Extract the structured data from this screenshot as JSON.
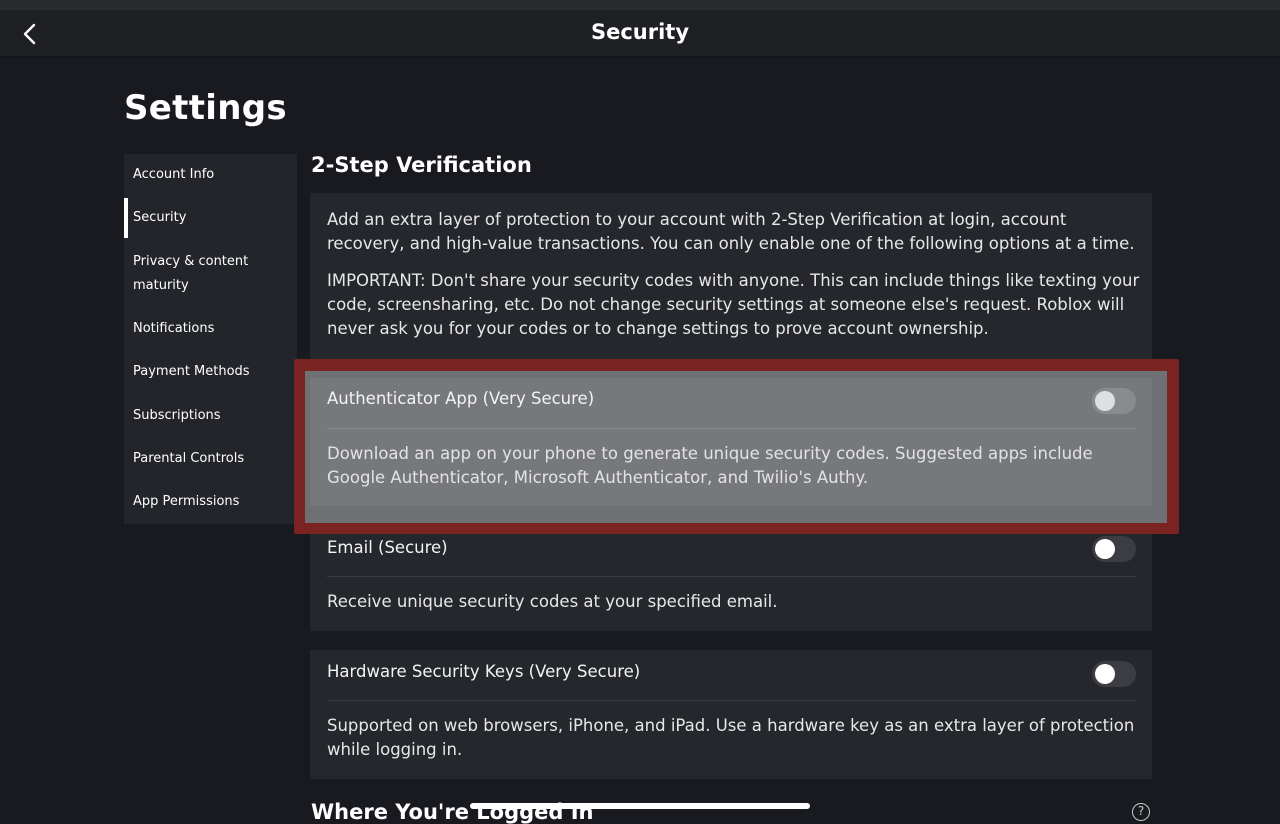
{
  "header": {
    "title": "Security",
    "back_icon": "chevron-left-icon"
  },
  "page": {
    "title": "Settings"
  },
  "sidebar": {
    "items": [
      {
        "label": "Account Info",
        "active": false
      },
      {
        "label": "Security",
        "active": true
      },
      {
        "label": "Privacy & content maturity",
        "active": false
      },
      {
        "label": "Notifications",
        "active": false
      },
      {
        "label": "Payment Methods",
        "active": false
      },
      {
        "label": "Subscriptions",
        "active": false
      },
      {
        "label": "Parental Controls",
        "active": false
      },
      {
        "label": "App Permissions",
        "active": false
      }
    ]
  },
  "two_step": {
    "title": "2-Step Verification",
    "intro": "Add an extra layer of protection to your account with 2-Step Verification at login, account recovery, and high-value transactions. You can only enable one of the following options at a time.",
    "important": "IMPORTANT: Don't share your security codes with anyone. This can include things like texting your code, screensharing, etc. Do not change security settings at someone else's request. Roblox will never ask you for your codes or to change settings to prove account ownership.",
    "options": [
      {
        "title": "Authenticator App (Very Secure)",
        "description": "Download an app on your phone to generate unique security codes. Suggested apps include Google Authenticator, Microsoft Authenticator, and Twilio's Authy.",
        "enabled": false,
        "highlighted": true
      },
      {
        "title": "Email (Secure)",
        "description": "Receive unique security codes at your specified email.",
        "enabled": false,
        "highlighted": false
      },
      {
        "title": "Hardware Security Keys (Very Secure)",
        "description": "Supported on web browsers, iPhone, and iPad. Use a hardware key as an extra layer of protection while logging in.",
        "enabled": false,
        "highlighted": false
      }
    ]
  },
  "logged_in": {
    "title": "Where You're Logged In",
    "help_icon": "help-icon",
    "help_glyph": "?"
  },
  "colors": {
    "background": "#191a1f",
    "card": "#25272c",
    "highlight_border": "#7b2222",
    "toggle_off": "#3b3d43"
  }
}
